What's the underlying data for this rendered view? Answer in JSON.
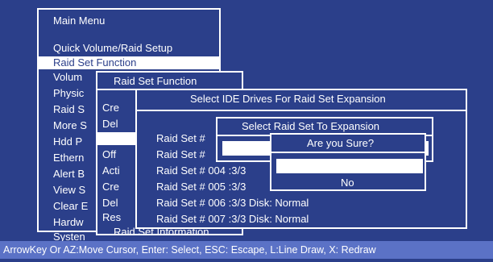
{
  "main_menu": {
    "title": "Main Menu",
    "items": [
      "Quick Volume/Raid Setup",
      "Raid Set Function",
      "Volum",
      "Physic",
      "Raid S",
      "More S",
      "Hdd P",
      "Ethern",
      "Alert B",
      "View S",
      "Clear E",
      "Hardw",
      "Systen"
    ]
  },
  "raid_set_function": {
    "title": "Raid Set Function",
    "items": [
      "Cre",
      "Del",
      "Off",
      "Acti",
      "Cre",
      "Del",
      "Res",
      "Raid Set Information"
    ]
  },
  "select_drives": {
    "title": "Select IDE Drives For Raid Set Expansion",
    "rows": [
      "Raid Set #",
      "Raid Set #",
      "Raid Set # 004 :3/3",
      "Raid Set # 005 :3/3",
      "Raid Set # 006 :3/3  Disk: Normal",
      "Raid Set # 007 :3/3  Disk: Normal"
    ]
  },
  "select_raid_set": {
    "title": "Select Raid Set To Expansion"
  },
  "confirm": {
    "title": "Are you Sure?",
    "yes": "",
    "no": "No"
  },
  "status_bar": {
    "text": "ArrowKey Or AZ:Move Cursor, Enter: Select, ESC: Escape, L:Line Draw, X: Redraw"
  }
}
